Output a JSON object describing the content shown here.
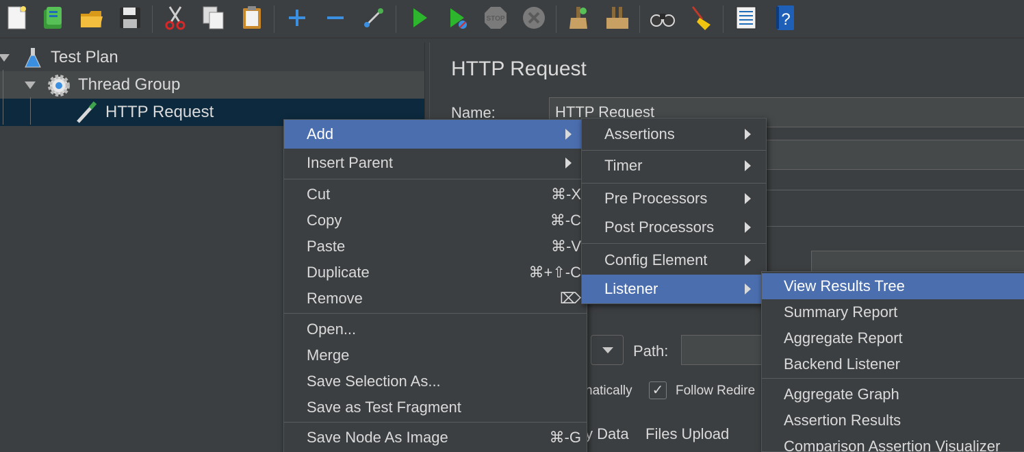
{
  "toolbar": {
    "icons": [
      "new-icon",
      "templates-icon",
      "open-icon",
      "save-icon",
      "cut-icon",
      "copy-icon",
      "paste-icon",
      "expand-icon",
      "collapse-icon",
      "toggle-icon",
      "start-icon",
      "start-no-pause-icon",
      "stop-icon",
      "shutdown-icon",
      "clear-icon",
      "clear-all-icon",
      "search-icon",
      "reset-search-icon",
      "function-helper-icon",
      "help-icon"
    ]
  },
  "tree": {
    "test_plan": "Test Plan",
    "thread_group": "Thread Group",
    "http_request": "HTTP Request"
  },
  "panel": {
    "title": "HTTP Request",
    "name_label": "Name:",
    "name_value": "HTTP Request",
    "path_label": "Path:",
    "auto_redirect_label": "natically",
    "follow_redirects_label": "Follow Redire",
    "body_data_tab": "y Data",
    "files_upload_tab": "Files Upload"
  },
  "context_menu": {
    "items": [
      {
        "label": "Add",
        "submenu": true
      },
      {
        "label": "Insert Parent",
        "submenu": true
      },
      {
        "label": "Cut",
        "shortcut": "⌘-X"
      },
      {
        "label": "Copy",
        "shortcut": "⌘-C"
      },
      {
        "label": "Paste",
        "shortcut": "⌘-V"
      },
      {
        "label": "Duplicate",
        "shortcut": "⌘+⇧-C"
      },
      {
        "label": "Remove",
        "shortcut": "⌦"
      },
      {
        "label": "Open..."
      },
      {
        "label": "Merge"
      },
      {
        "label": "Save Selection As..."
      },
      {
        "label": "Save as Test Fragment"
      },
      {
        "label": "Save Node As Image",
        "shortcut": "⌘-G"
      }
    ]
  },
  "add_submenu": {
    "items": [
      {
        "label": "Assertions"
      },
      {
        "label": "Timer"
      },
      {
        "label": "Pre Processors"
      },
      {
        "label": "Post Processors"
      },
      {
        "label": "Config Element"
      },
      {
        "label": "Listener"
      }
    ]
  },
  "listener_submenu": {
    "items": [
      {
        "label": "View Results Tree"
      },
      {
        "label": "Summary Report"
      },
      {
        "label": "Aggregate Report"
      },
      {
        "label": "Backend Listener"
      },
      {
        "label": "Aggregate Graph"
      },
      {
        "label": "Assertion Results"
      },
      {
        "label": "Comparison Assertion Visualizer"
      }
    ]
  },
  "colors": {
    "background": "#3c3f41",
    "menu_highlight": "#4b6eaf",
    "tree_selection": "#0d293e",
    "text": "#dadada"
  }
}
